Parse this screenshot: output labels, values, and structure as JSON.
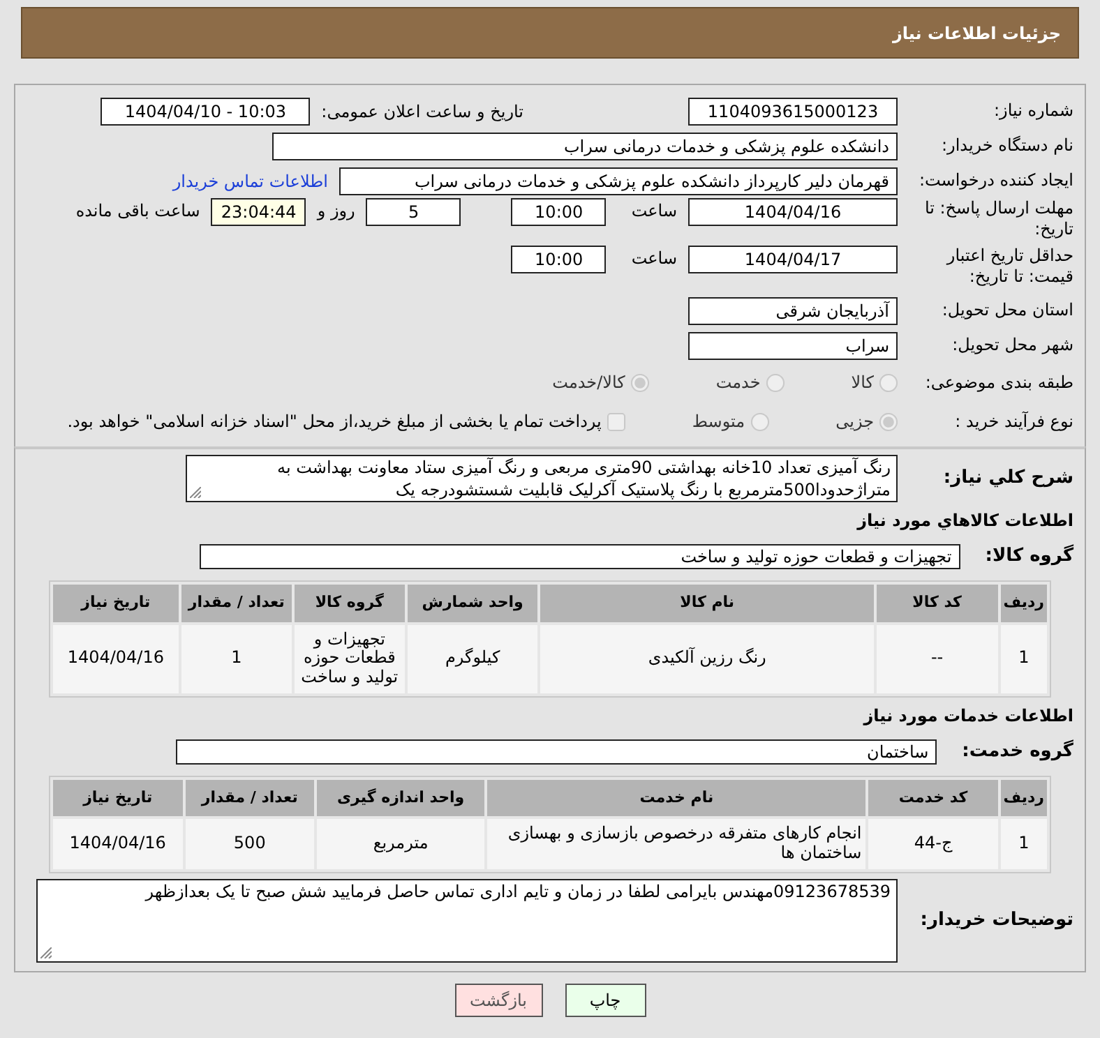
{
  "header": {
    "title": "جزئیات اطلاعات نیاز"
  },
  "need_number": {
    "label": "شماره نیاز:",
    "value": "1104093615000123"
  },
  "announce": {
    "label": "تاریخ و ساعت اعلان عمومی:",
    "value": "1404/04/10 - 10:03"
  },
  "buyer_org": {
    "label": "نام دستگاه خریدار:",
    "value": "دانشکده علوم پزشکی و خدمات درمانی سراب"
  },
  "requester": {
    "label": "ایجاد کننده درخواست:",
    "value": "قهرمان دلیر کارپرداز دانشکده علوم پزشکی و خدمات درمانی سراب",
    "link": "اطلاعات تماس خریدار"
  },
  "deadline": {
    "label": "مهلت ارسال پاسخ: تا تاریخ:",
    "date": "1404/04/16",
    "time_label": "ساعت",
    "time": "10:00",
    "days": "5",
    "days_label": "روز و",
    "remaining": "23:04:44",
    "remaining_label": "ساعت باقی مانده"
  },
  "validity": {
    "label": "حداقل تاریخ اعتبار قیمت: تا تاریخ:",
    "date": "1404/04/17",
    "time_label": "ساعت",
    "time": "10:00"
  },
  "province": {
    "label": "استان محل تحویل:",
    "value": "آذربایجان شرقی"
  },
  "city": {
    "label": "شهر محل تحویل:",
    "value": "سراب"
  },
  "category": {
    "label": "طبقه بندی موضوعی:",
    "options": [
      {
        "label": "کالا",
        "selected": false
      },
      {
        "label": "خدمت",
        "selected": false
      },
      {
        "label": "کالا/خدمت",
        "selected": true
      }
    ]
  },
  "purchase_type": {
    "label": "نوع فرآیند خرید :",
    "options": [
      {
        "label": "جزیی",
        "selected": true
      },
      {
        "label": "متوسط",
        "selected": false
      }
    ],
    "treasury": {
      "checked": false,
      "text": "پرداخت تمام یا بخشی از مبلغ خرید،از محل \"اسناد خزانه اسلامی\" خواهد بود."
    }
  },
  "description": {
    "label": "شرح کلي نیاز:",
    "value": "رنگ آمیزی تعداد 10خانه بهداشتی 90متری مربعی و رنگ آمیزی ستاد معاونت بهداشت به متراژحدودا500مترمربع با رنگ پلاستیک آکرلیک قابلیت شستشودرجه یک"
  },
  "goods": {
    "heading": "اطلاعات کالاهاي مورد نیاز",
    "group_label": "گروه کالا:",
    "group": "تجهیزات و قطعات حوزه تولید و ساخت",
    "table": {
      "columns": [
        "ردیف",
        "کد کالا",
        "نام کالا",
        "واحد شمارش",
        "گروه کالا",
        "تعداد / مقدار",
        "تاریخ نیاز"
      ],
      "rows": [
        [
          "1",
          "--",
          "رنگ رزین آلکیدی",
          "کیلوگرم",
          "تجهیزات و قطعات حوزه تولید و ساخت",
          "1",
          "1404/04/16"
        ]
      ]
    }
  },
  "services": {
    "heading": "اطلاعات خدمات مورد نیاز",
    "group_label": "گروه خدمت:",
    "group": "ساختمان",
    "table": {
      "columns": [
        "ردیف",
        "کد خدمت",
        "نام خدمت",
        "واحد اندازه گیری",
        "تعداد / مقدار",
        "تاریخ نیاز"
      ],
      "rows": [
        [
          "1",
          "ج-44",
          "انجام کارهای متفرقه درخصوص بازسازی و بهسازی ساختمان ها",
          "مترمربع",
          "500",
          "1404/04/16"
        ]
      ]
    }
  },
  "buyer_notes": {
    "label": "توضیحات خریدار:",
    "value": "09123678539مهندس بایرامی لطفا در زمان و تایم اداری تماس حاصل فرمایید شش صبح تا یک بعدازظهر"
  },
  "buttons": [
    {
      "label": "چاپ",
      "kind": "print"
    },
    {
      "label": "بازگشت",
      "kind": "back"
    }
  ]
}
